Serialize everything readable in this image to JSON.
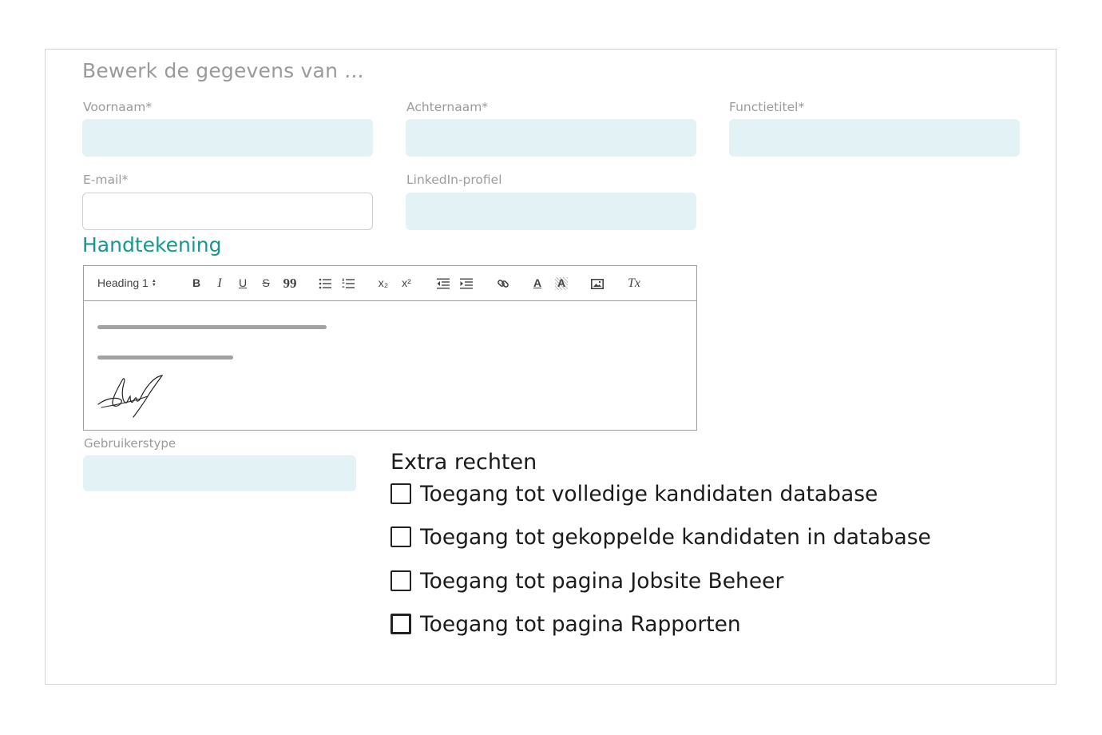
{
  "form": {
    "title": "Bewerk de gegevens van ...",
    "fields": {
      "first_name_label": "Voornaam*",
      "last_name_label": "Achternaam*",
      "job_title_label": "Functietitel*",
      "email_label": "E-mail*",
      "linkedin_label": "LinkedIn-profiel",
      "user_type_label": "Gebruikerstype"
    },
    "signature": {
      "heading": "Handtekening",
      "toolbar": {
        "heading_select": "Heading 1",
        "bold": "B",
        "italic": "I",
        "underline": "U",
        "strike": "S",
        "quote": "99",
        "subscript": "x₂",
        "superscript": "x²",
        "text_color": "A",
        "highlight": "A",
        "clear_format": "Tx"
      }
    },
    "rights": {
      "heading": "Extra rechten",
      "options": [
        {
          "label": "Toegang tot volledige kandidaten database",
          "checked": false
        },
        {
          "label": "Toegang tot gekoppelde kandidaten in database",
          "checked": false
        },
        {
          "label": "Toegang tot pagina Jobsite Beheer",
          "checked": false
        },
        {
          "label": "Toegang tot pagina Rapporten",
          "checked": false
        }
      ]
    }
  },
  "colors": {
    "field_bg": "#e3f2f5",
    "accent": "#16998c",
    "label": "#9b9b9b"
  }
}
